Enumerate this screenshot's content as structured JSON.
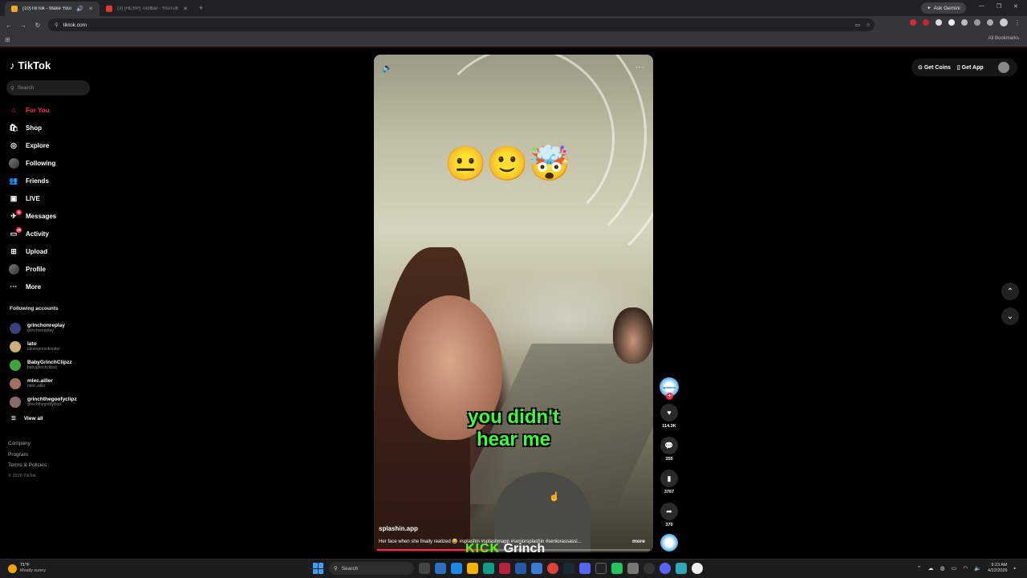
{
  "browser": {
    "tabs": [
      {
        "title": "(10)TikTok - Make Your Day",
        "active": true
      },
      {
        "title": "(3) [HCRP] Toolbar - YouTube",
        "active": false
      }
    ],
    "gemini_label": "Ask Gemini",
    "url": "tiktok.com",
    "all_bookmarks": "All Bookmarks"
  },
  "tiktok": {
    "logo": "TikTok",
    "search_placeholder": "Search",
    "nav": [
      {
        "label": "For You",
        "icon": "home-icon",
        "active": true
      },
      {
        "label": "Shop",
        "icon": "shop-icon"
      },
      {
        "label": "Explore",
        "icon": "compass-icon"
      },
      {
        "label": "Following",
        "icon": "following-avatar-icon"
      },
      {
        "label": "Friends",
        "icon": "friends-icon"
      },
      {
        "label": "LIVE",
        "icon": "live-icon"
      },
      {
        "label": "Messages",
        "icon": "messages-icon",
        "badge": "6"
      },
      {
        "label": "Activity",
        "icon": "activity-icon",
        "badge": "10"
      },
      {
        "label": "Upload",
        "icon": "upload-icon"
      },
      {
        "label": "Profile",
        "icon": "profile-avatar-icon"
      },
      {
        "label": "More",
        "icon": "more-icon"
      }
    ],
    "following_title": "Following accounts",
    "following": [
      {
        "name": "grinchonreplay",
        "handle": "grinchonreplay",
        "color": "#3b3f7a"
      },
      {
        "name": "lato",
        "handle": "latoexpressbonitor",
        "color": "#c9b27a"
      },
      {
        "name": "BabyGrinchClipzz",
        "handle": "babygrinchclipzz",
        "color": "#3fa33f"
      },
      {
        "name": "mlec.ailler",
        "handle": "mlec.ailler",
        "color": "#a07060"
      },
      {
        "name": "grinchthegoofyclipz",
        "handle": "grinchthegoofyclipz",
        "color": "#8a6a6a"
      }
    ],
    "view_all": "View all",
    "footer": [
      "Company",
      "Program",
      "Terms & Policies"
    ],
    "copyright": "© 2026 TikTok",
    "header": {
      "get_coins": "Get Coins",
      "get_app": "Get App"
    }
  },
  "video": {
    "emojis": "😐🙂🤯",
    "caption_line1": "you didn't",
    "caption_line2": "hear me",
    "author": "splashin.app",
    "description": "Her face when she finally realized 😂 #splashin #splashinapp #seniorsplashin #seniorassassi...",
    "more": "more",
    "progress_percent": 0.4,
    "stats": {
      "likes": "114.3K",
      "comments": "355",
      "saves": "3767",
      "shares": "370"
    },
    "creator_avatar_text": "splashin"
  },
  "overlay": {
    "kick": "KICK",
    "grinch": "Grinch"
  },
  "taskbar": {
    "temp": "71°F",
    "weather": "Mostly sunny",
    "search": "Search",
    "time": "9:23 AM",
    "date": "4/22/2026"
  }
}
